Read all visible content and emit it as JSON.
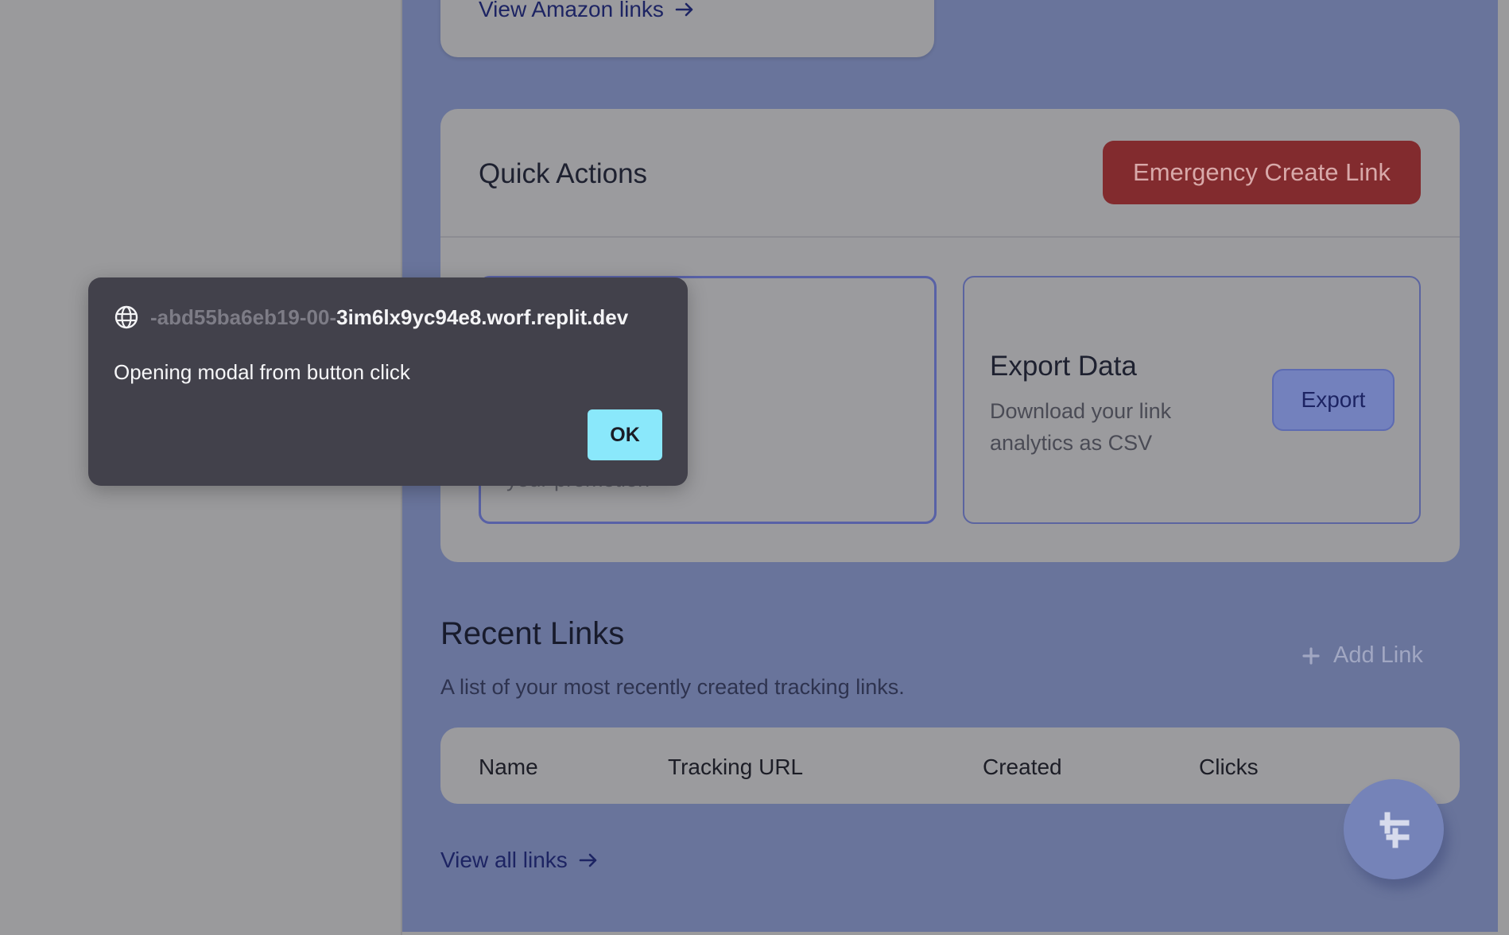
{
  "dialog": {
    "host_prefix": "-abd55ba6eb19-00-",
    "host_main": "3im6lx9yc94e8.worf.replit.dev",
    "message": "Opening modal from button click",
    "ok_label": "OK"
  },
  "amazon": {
    "link_label": "View Amazon links"
  },
  "quick_actions": {
    "title": "Quick Actions",
    "emergency_label": "Emergency Create Link",
    "left_box": {
      "desc_partial": "your promotion"
    },
    "export": {
      "title": "Export Data",
      "description": "Download your link analytics as CSV",
      "button_label": "Export"
    }
  },
  "recent_links": {
    "title": "Recent Links",
    "subtitle": "A list of your most recently created tracking links.",
    "add_label": "Add Link",
    "columns": [
      "Name",
      "Tracking URL",
      "Created",
      "Clicks"
    ],
    "view_all_label": "View all links"
  },
  "icons": {
    "dialog": "globe-icon",
    "links": "arrow-right-icon",
    "add": "plus-icon",
    "fab": "replit-icon"
  },
  "colors": {
    "overlay_main": "#69749b",
    "emergency": "#822b2e",
    "ok_button": "#8ae8fb",
    "dialog_bg": "#42414b"
  }
}
